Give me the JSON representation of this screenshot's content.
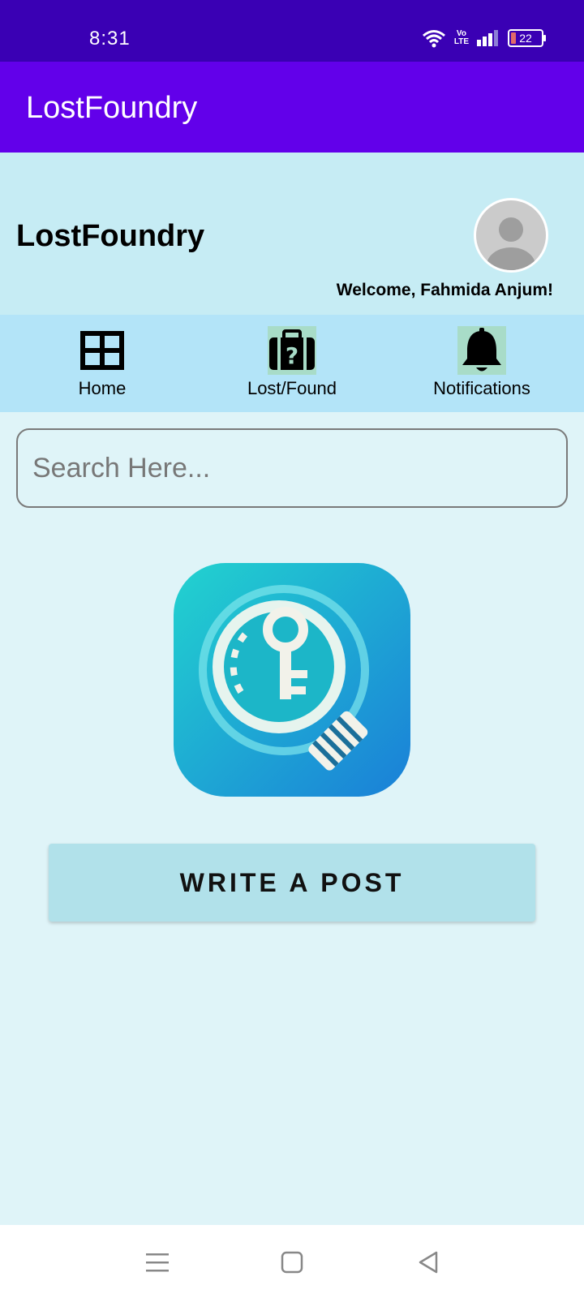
{
  "status_bar": {
    "time": "8:31",
    "network_label_top": "Vo",
    "network_label_bottom": "LTE",
    "battery": "22"
  },
  "app_bar": {
    "title": "LostFoundry"
  },
  "header": {
    "brand": "LostFoundry",
    "welcome": "Welcome, Fahmida Anjum!"
  },
  "nav": {
    "items": [
      {
        "label": "Home",
        "icon": "grid-icon"
      },
      {
        "label": "Lost/Found",
        "icon": "briefcase-question-icon"
      },
      {
        "label": "Notifications",
        "icon": "bell-icon"
      }
    ]
  },
  "search": {
    "placeholder": "Search Here...",
    "value": ""
  },
  "actions": {
    "write_post": "WRITE A POST"
  },
  "colors": {
    "status_bar": "#3a00b4",
    "app_bar": "#6200ea",
    "header_bg": "#c6ecf4",
    "nav_bg": "#b3e4f8",
    "page_bg": "#dff4f8",
    "button_bg": "#b1e1ea"
  }
}
